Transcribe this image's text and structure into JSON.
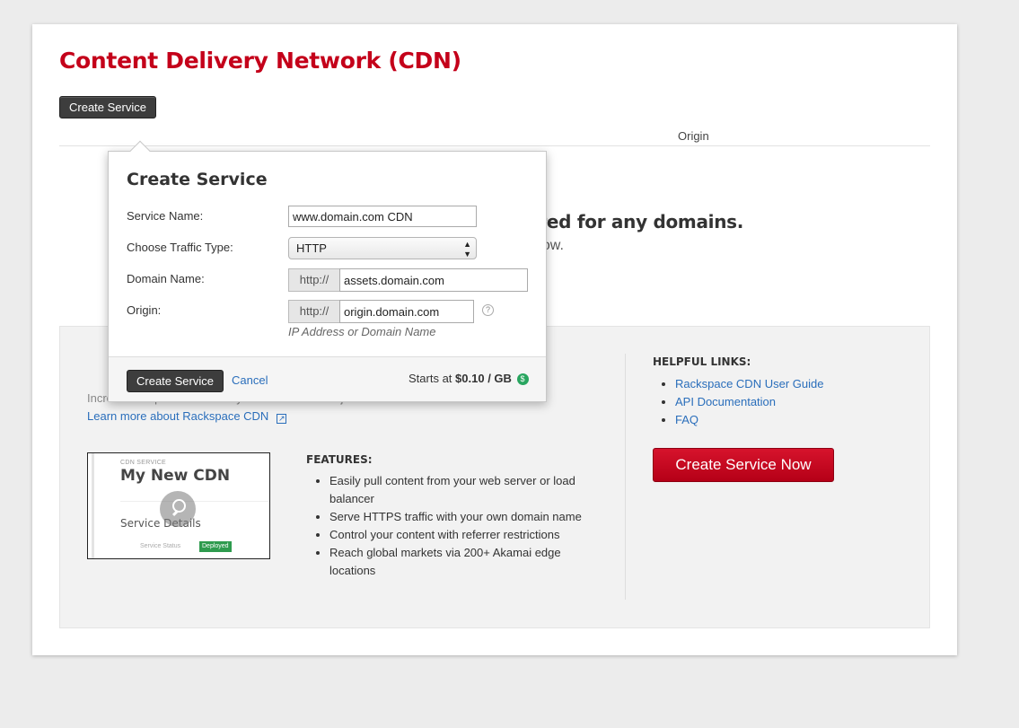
{
  "page": {
    "title": "Content Delivery Network (CDN)",
    "create_button": "Create Service",
    "table": {
      "origin_header": "Origin"
    },
    "empty_state": {
      "heading": "There are no services configured for any domains.",
      "subtext": "Create a service now."
    }
  },
  "promo": {
    "description": "Increase the performance of your web content in just minutes.",
    "learn_more": "Learn more about Rackspace CDN",
    "thumbnail": {
      "kicker": "CDN SERVICE",
      "title": "My New CDN",
      "section": "Service Details",
      "status_label": "Service Status",
      "status_badge": "Deployed"
    },
    "features_title": "FEATURES:",
    "features": [
      "Easily pull content from your web server or load balancer",
      "Serve HTTPS traffic with your own domain name",
      "Control your content with referrer restrictions",
      "Reach global markets via 200+ Akamai edge locations"
    ],
    "links_title": "HELPFUL LINKS:",
    "links": [
      "Rackspace CDN User Guide",
      "API Documentation",
      "FAQ"
    ],
    "cta": "Create Service Now"
  },
  "popover": {
    "title": "Create Service",
    "fields": {
      "service_name": {
        "label": "Service Name:",
        "value": "www.domain.com CDN"
      },
      "traffic_type": {
        "label": "Choose Traffic Type:",
        "value": "HTTP"
      },
      "domain_name": {
        "label": "Domain Name:",
        "prefix": "http://",
        "value": "assets.domain.com"
      },
      "origin": {
        "label": "Origin:",
        "prefix": "http://",
        "value": "origin.domain.com",
        "help": "?",
        "hint": "IP Address or Domain Name"
      }
    },
    "footer": {
      "create": "Create Service",
      "cancel": "Cancel",
      "price_prefix": "Starts at",
      "price": "$0.10 / GB",
      "price_icon": "$"
    }
  },
  "colors": {
    "brand_red": "#c4001a",
    "link_blue": "#2a6ebb",
    "deployed_green": "#2e9b4e"
  }
}
